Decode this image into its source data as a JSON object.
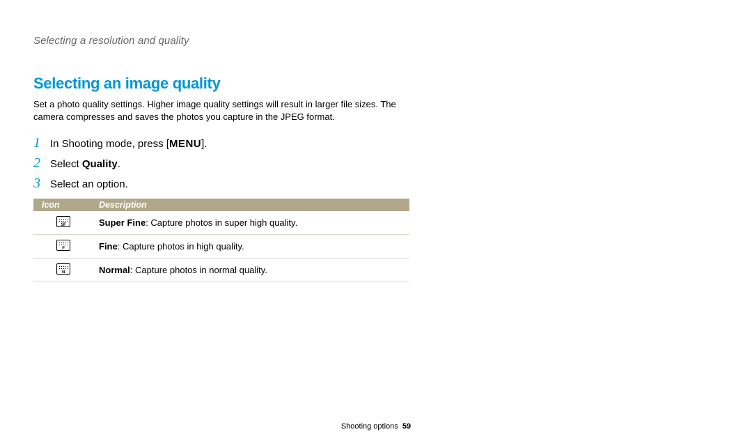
{
  "breadcrumb": "Selecting a resolution and quality",
  "heading": "Selecting an image quality",
  "intro": "Set a photo quality settings. Higher image quality settings will result in larger file sizes. The camera compresses and saves the photos you capture in the JPEG format.",
  "steps": {
    "s1": {
      "num": "1",
      "prefix": "In Shooting mode, press [",
      "menu": "MENU",
      "suffix": "]."
    },
    "s2": {
      "num": "2",
      "prefix": "Select ",
      "bold": "Quality",
      "suffix": "."
    },
    "s3": {
      "num": "3",
      "text": "Select an option."
    }
  },
  "table": {
    "headers": {
      "icon": "Icon",
      "description": "Description"
    },
    "rows": [
      {
        "iconLabel": "SF",
        "bold": "Super Fine",
        "rest": ": Capture photos in super high quality."
      },
      {
        "iconLabel": "F",
        "bold": "Fine",
        "rest": ": Capture photos in high quality."
      },
      {
        "iconLabel": "N",
        "bold": "Normal",
        "rest": ": Capture photos in normal quality."
      }
    ]
  },
  "footer": {
    "section": "Shooting options",
    "page": "59"
  }
}
